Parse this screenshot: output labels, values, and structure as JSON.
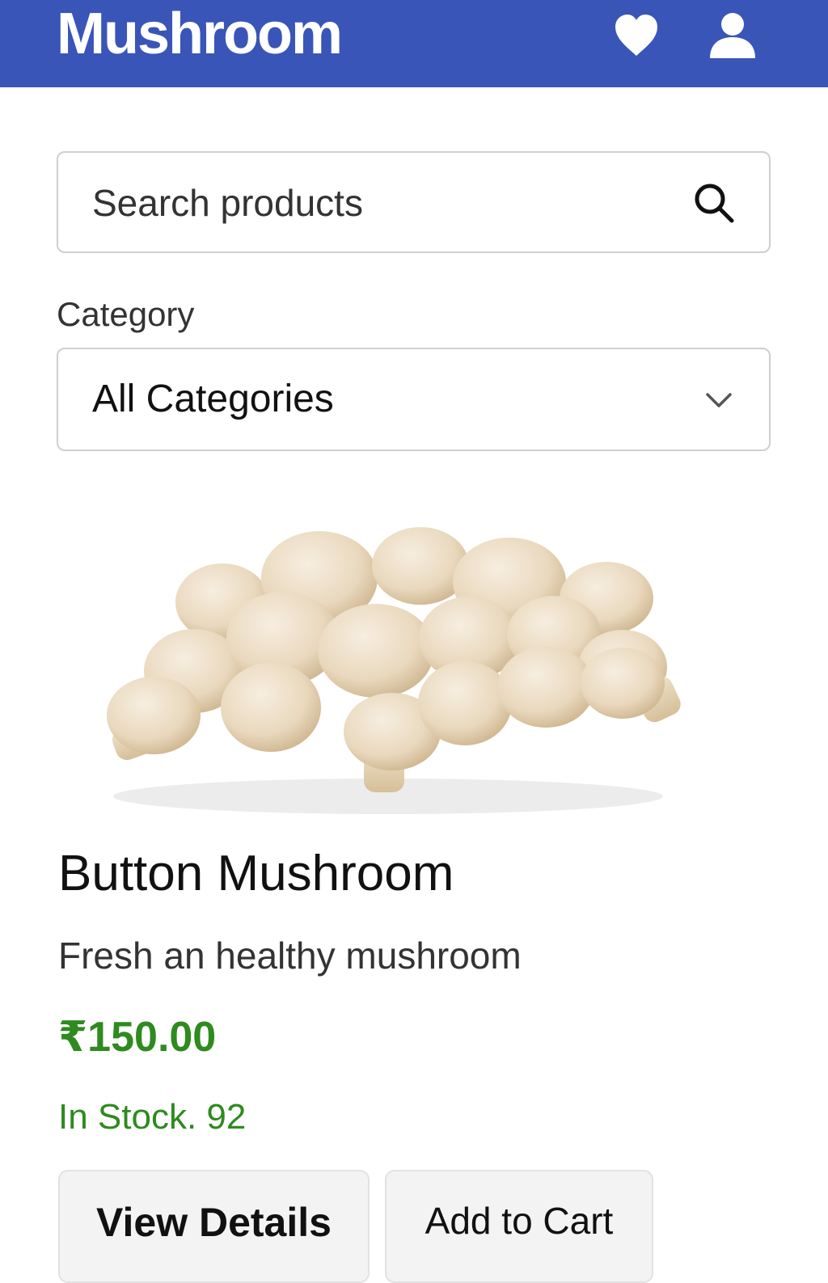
{
  "header": {
    "brand": "Mushroom",
    "icons": {
      "favorites": "heart-icon",
      "account": "user-icon"
    },
    "background_color": "#3a55b8"
  },
  "search": {
    "placeholder": "Search products",
    "value": "",
    "icon": "search-icon"
  },
  "filter": {
    "label": "Category",
    "selected": "All Categories",
    "icon": "chevron-down-icon"
  },
  "product": {
    "image": "button-mushrooms-photo",
    "name": "Button Mushroom",
    "description": "Fresh an healthy mushroom",
    "price": "₹150.00",
    "stock": "In Stock. 92",
    "accent_color": "#2f8a1f"
  },
  "actions": {
    "view_details": "View Details",
    "add_to_cart": "Add to Cart"
  }
}
